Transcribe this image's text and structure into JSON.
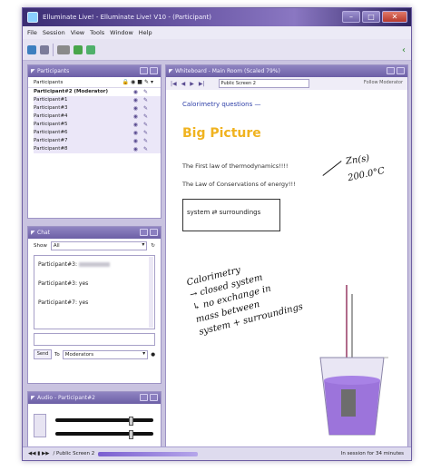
{
  "window": {
    "title": "Elluminate Live! - Elluminate Live! V10 - (Participant)",
    "controls": {
      "minimize": "–",
      "maximize": "□",
      "close": "✕"
    }
  },
  "menu": [
    "File",
    "Session",
    "View",
    "Tools",
    "Window",
    "Help"
  ],
  "participants": {
    "title": "Participants",
    "header_label": "Participants",
    "items": [
      {
        "label": "Participant#2 (Moderator)",
        "moderator": true
      },
      {
        "label": "Participant#1"
      },
      {
        "label": "Participant#3"
      },
      {
        "label": "Participant#4"
      },
      {
        "label": "Participant#5"
      },
      {
        "label": "Participant#6"
      },
      {
        "label": "Participant#7"
      },
      {
        "label": "Participant#8"
      }
    ]
  },
  "chat": {
    "title": "Chat",
    "show_label": "Show",
    "show_value": "All",
    "messages": [
      {
        "sender": "Participant#3:",
        "text": ""
      },
      {
        "sender": "Participant#3:",
        "text": "yes"
      },
      {
        "sender": "Participant#7:",
        "text": "yes"
      }
    ],
    "send_label": "Send",
    "to_label": "To",
    "to_value": "Moderators"
  },
  "audio": {
    "title": "Audio - Participant#2",
    "talk_level": 0.75,
    "volume_level": 0.75
  },
  "whiteboard": {
    "title": "Whiteboard - Main Room (Scaled 79%)",
    "screen_select": "Public Screen 2",
    "follow_label": "Follow Moderator",
    "heading": "Calorimetry questions —",
    "big_picture": "Big Picture",
    "law1": "The First law of thermodynamics!!!!",
    "law2": "The Law of Conservations of energy!!!",
    "system_text": "system",
    "surroundings_text": "surroundings",
    "handwriting": {
      "zn": "Zn(s)",
      "temp": "200.0°C",
      "note1": "Calorimetry",
      "note2": "→ closed system",
      "note3": "↳ no exchange in",
      "note4": "mass between",
      "note5": "system + surroundings"
    }
  },
  "statusbar": {
    "screen_label": "/ Public Screen 2",
    "session_text": "In session for 34 minutes"
  }
}
